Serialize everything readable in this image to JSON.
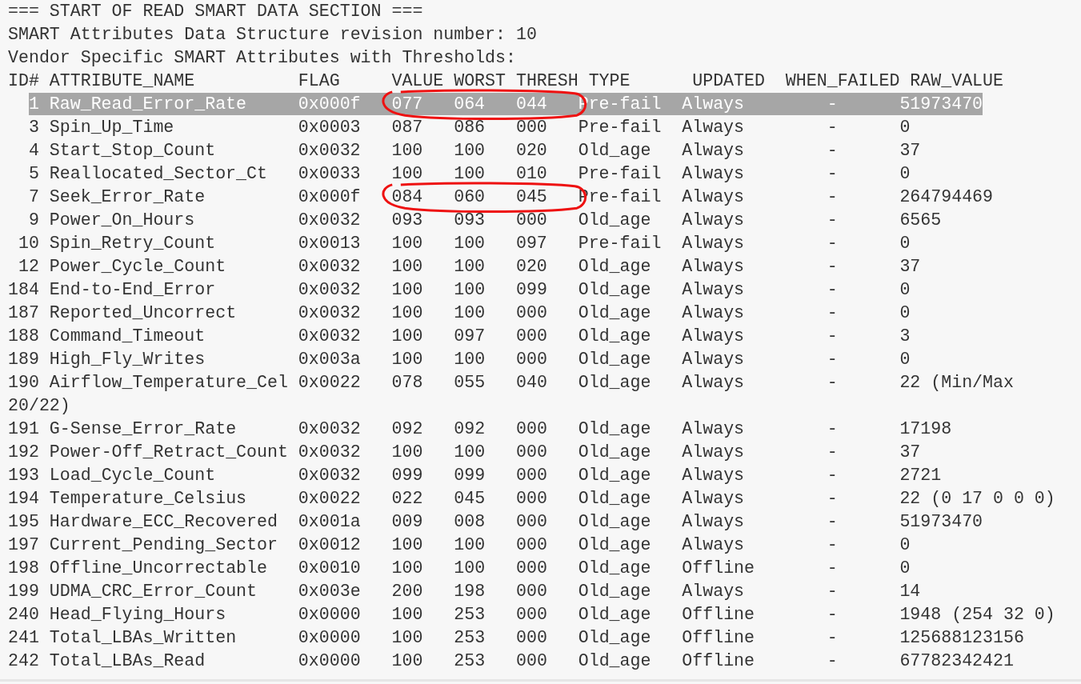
{
  "intro_lines": [
    "=== START OF READ SMART DATA SECTION ===",
    "SMART Attributes Data Structure revision number: 10",
    "Vendor Specific SMART Attributes with Thresholds:"
  ],
  "columns": [
    "ID#",
    "ATTRIBUTE_NAME",
    "FLAG",
    "VALUE",
    "WORST",
    "THRESH",
    "TYPE",
    "UPDATED",
    "WHEN_FAILED",
    "RAW_VALUE"
  ],
  "rows": [
    {
      "id": "1",
      "name": "Raw_Read_Error_Rate",
      "flag": "0x000f",
      "value": "077",
      "worst": "064",
      "thresh": "044",
      "type": "Pre-fail",
      "updated": "Always",
      "when_failed": "-",
      "raw_value": "51973470",
      "selected": true,
      "circled": true
    },
    {
      "id": "3",
      "name": "Spin_Up_Time",
      "flag": "0x0003",
      "value": "087",
      "worst": "086",
      "thresh": "000",
      "type": "Pre-fail",
      "updated": "Always",
      "when_failed": "-",
      "raw_value": "0",
      "selected": false,
      "circled": false
    },
    {
      "id": "4",
      "name": "Start_Stop_Count",
      "flag": "0x0032",
      "value": "100",
      "worst": "100",
      "thresh": "020",
      "type": "Old_age",
      "updated": "Always",
      "when_failed": "-",
      "raw_value": "37",
      "selected": false,
      "circled": false
    },
    {
      "id": "5",
      "name": "Reallocated_Sector_Ct",
      "flag": "0x0033",
      "value": "100",
      "worst": "100",
      "thresh": "010",
      "type": "Pre-fail",
      "updated": "Always",
      "when_failed": "-",
      "raw_value": "0",
      "selected": false,
      "circled": false
    },
    {
      "id": "7",
      "name": "Seek_Error_Rate",
      "flag": "0x000f",
      "value": "084",
      "worst": "060",
      "thresh": "045",
      "type": "Pre-fail",
      "updated": "Always",
      "when_failed": "-",
      "raw_value": "264794469",
      "selected": false,
      "circled": true
    },
    {
      "id": "9",
      "name": "Power_On_Hours",
      "flag": "0x0032",
      "value": "093",
      "worst": "093",
      "thresh": "000",
      "type": "Old_age",
      "updated": "Always",
      "when_failed": "-",
      "raw_value": "6565",
      "selected": false,
      "circled": false
    },
    {
      "id": "10",
      "name": "Spin_Retry_Count",
      "flag": "0x0013",
      "value": "100",
      "worst": "100",
      "thresh": "097",
      "type": "Pre-fail",
      "updated": "Always",
      "when_failed": "-",
      "raw_value": "0",
      "selected": false,
      "circled": false
    },
    {
      "id": "12",
      "name": "Power_Cycle_Count",
      "flag": "0x0032",
      "value": "100",
      "worst": "100",
      "thresh": "020",
      "type": "Old_age",
      "updated": "Always",
      "when_failed": "-",
      "raw_value": "37",
      "selected": false,
      "circled": false
    },
    {
      "id": "184",
      "name": "End-to-End_Error",
      "flag": "0x0032",
      "value": "100",
      "worst": "100",
      "thresh": "099",
      "type": "Old_age",
      "updated": "Always",
      "when_failed": "-",
      "raw_value": "0",
      "selected": false,
      "circled": false
    },
    {
      "id": "187",
      "name": "Reported_Uncorrect",
      "flag": "0x0032",
      "value": "100",
      "worst": "100",
      "thresh": "000",
      "type": "Old_age",
      "updated": "Always",
      "when_failed": "-",
      "raw_value": "0",
      "selected": false,
      "circled": false
    },
    {
      "id": "188",
      "name": "Command_Timeout",
      "flag": "0x0032",
      "value": "100",
      "worst": "097",
      "thresh": "000",
      "type": "Old_age",
      "updated": "Always",
      "when_failed": "-",
      "raw_value": "3",
      "selected": false,
      "circled": false
    },
    {
      "id": "189",
      "name": "High_Fly_Writes",
      "flag": "0x003a",
      "value": "100",
      "worst": "100",
      "thresh": "000",
      "type": "Old_age",
      "updated": "Always",
      "when_failed": "-",
      "raw_value": "0",
      "selected": false,
      "circled": false
    },
    {
      "id": "190",
      "name": "Airflow_Temperature_Cel",
      "flag": "0x0022",
      "value": "078",
      "worst": "055",
      "thresh": "040",
      "type": "Old_age",
      "updated": "Always",
      "when_failed": "-",
      "raw_value": "22 (Min/Max",
      "continuation": "20/22)",
      "selected": false,
      "circled": false
    },
    {
      "id": "191",
      "name": "G-Sense_Error_Rate",
      "flag": "0x0032",
      "value": "092",
      "worst": "092",
      "thresh": "000",
      "type": "Old_age",
      "updated": "Always",
      "when_failed": "-",
      "raw_value": "17198",
      "selected": false,
      "circled": false
    },
    {
      "id": "192",
      "name": "Power-Off_Retract_Count",
      "flag": "0x0032",
      "value": "100",
      "worst": "100",
      "thresh": "000",
      "type": "Old_age",
      "updated": "Always",
      "when_failed": "-",
      "raw_value": "37",
      "selected": false,
      "circled": false
    },
    {
      "id": "193",
      "name": "Load_Cycle_Count",
      "flag": "0x0032",
      "value": "099",
      "worst": "099",
      "thresh": "000",
      "type": "Old_age",
      "updated": "Always",
      "when_failed": "-",
      "raw_value": "2721",
      "selected": false,
      "circled": false
    },
    {
      "id": "194",
      "name": "Temperature_Celsius",
      "flag": "0x0022",
      "value": "022",
      "worst": "045",
      "thresh": "000",
      "type": "Old_age",
      "updated": "Always",
      "when_failed": "-",
      "raw_value": "22 (0 17 0 0 0)",
      "selected": false,
      "circled": false
    },
    {
      "id": "195",
      "name": "Hardware_ECC_Recovered",
      "flag": "0x001a",
      "value": "009",
      "worst": "008",
      "thresh": "000",
      "type": "Old_age",
      "updated": "Always",
      "when_failed": "-",
      "raw_value": "51973470",
      "selected": false,
      "circled": false
    },
    {
      "id": "197",
      "name": "Current_Pending_Sector",
      "flag": "0x0012",
      "value": "100",
      "worst": "100",
      "thresh": "000",
      "type": "Old_age",
      "updated": "Always",
      "when_failed": "-",
      "raw_value": "0",
      "selected": false,
      "circled": false
    },
    {
      "id": "198",
      "name": "Offline_Uncorrectable",
      "flag": "0x0010",
      "value": "100",
      "worst": "100",
      "thresh": "000",
      "type": "Old_age",
      "updated": "Offline",
      "when_failed": "-",
      "raw_value": "0",
      "selected": false,
      "circled": false
    },
    {
      "id": "199",
      "name": "UDMA_CRC_Error_Count",
      "flag": "0x003e",
      "value": "200",
      "worst": "198",
      "thresh": "000",
      "type": "Old_age",
      "updated": "Always",
      "when_failed": "-",
      "raw_value": "14",
      "selected": false,
      "circled": false
    },
    {
      "id": "240",
      "name": "Head_Flying_Hours",
      "flag": "0x0000",
      "value": "100",
      "worst": "253",
      "thresh": "000",
      "type": "Old_age",
      "updated": "Offline",
      "when_failed": "-",
      "raw_value": "1948 (254 32 0)",
      "selected": false,
      "circled": false
    },
    {
      "id": "241",
      "name": "Total_LBAs_Written",
      "flag": "0x0000",
      "value": "100",
      "worst": "253",
      "thresh": "000",
      "type": "Old_age",
      "updated": "Offline",
      "when_failed": "-",
      "raw_value": "125688123156",
      "selected": false,
      "circled": false
    },
    {
      "id": "242",
      "name": "Total_LBAs_Read",
      "flag": "0x0000",
      "value": "100",
      "worst": "253",
      "thresh": "000",
      "type": "Old_age",
      "updated": "Offline",
      "when_failed": "-",
      "raw_value": "67782342421",
      "selected": false,
      "circled": false
    }
  ]
}
